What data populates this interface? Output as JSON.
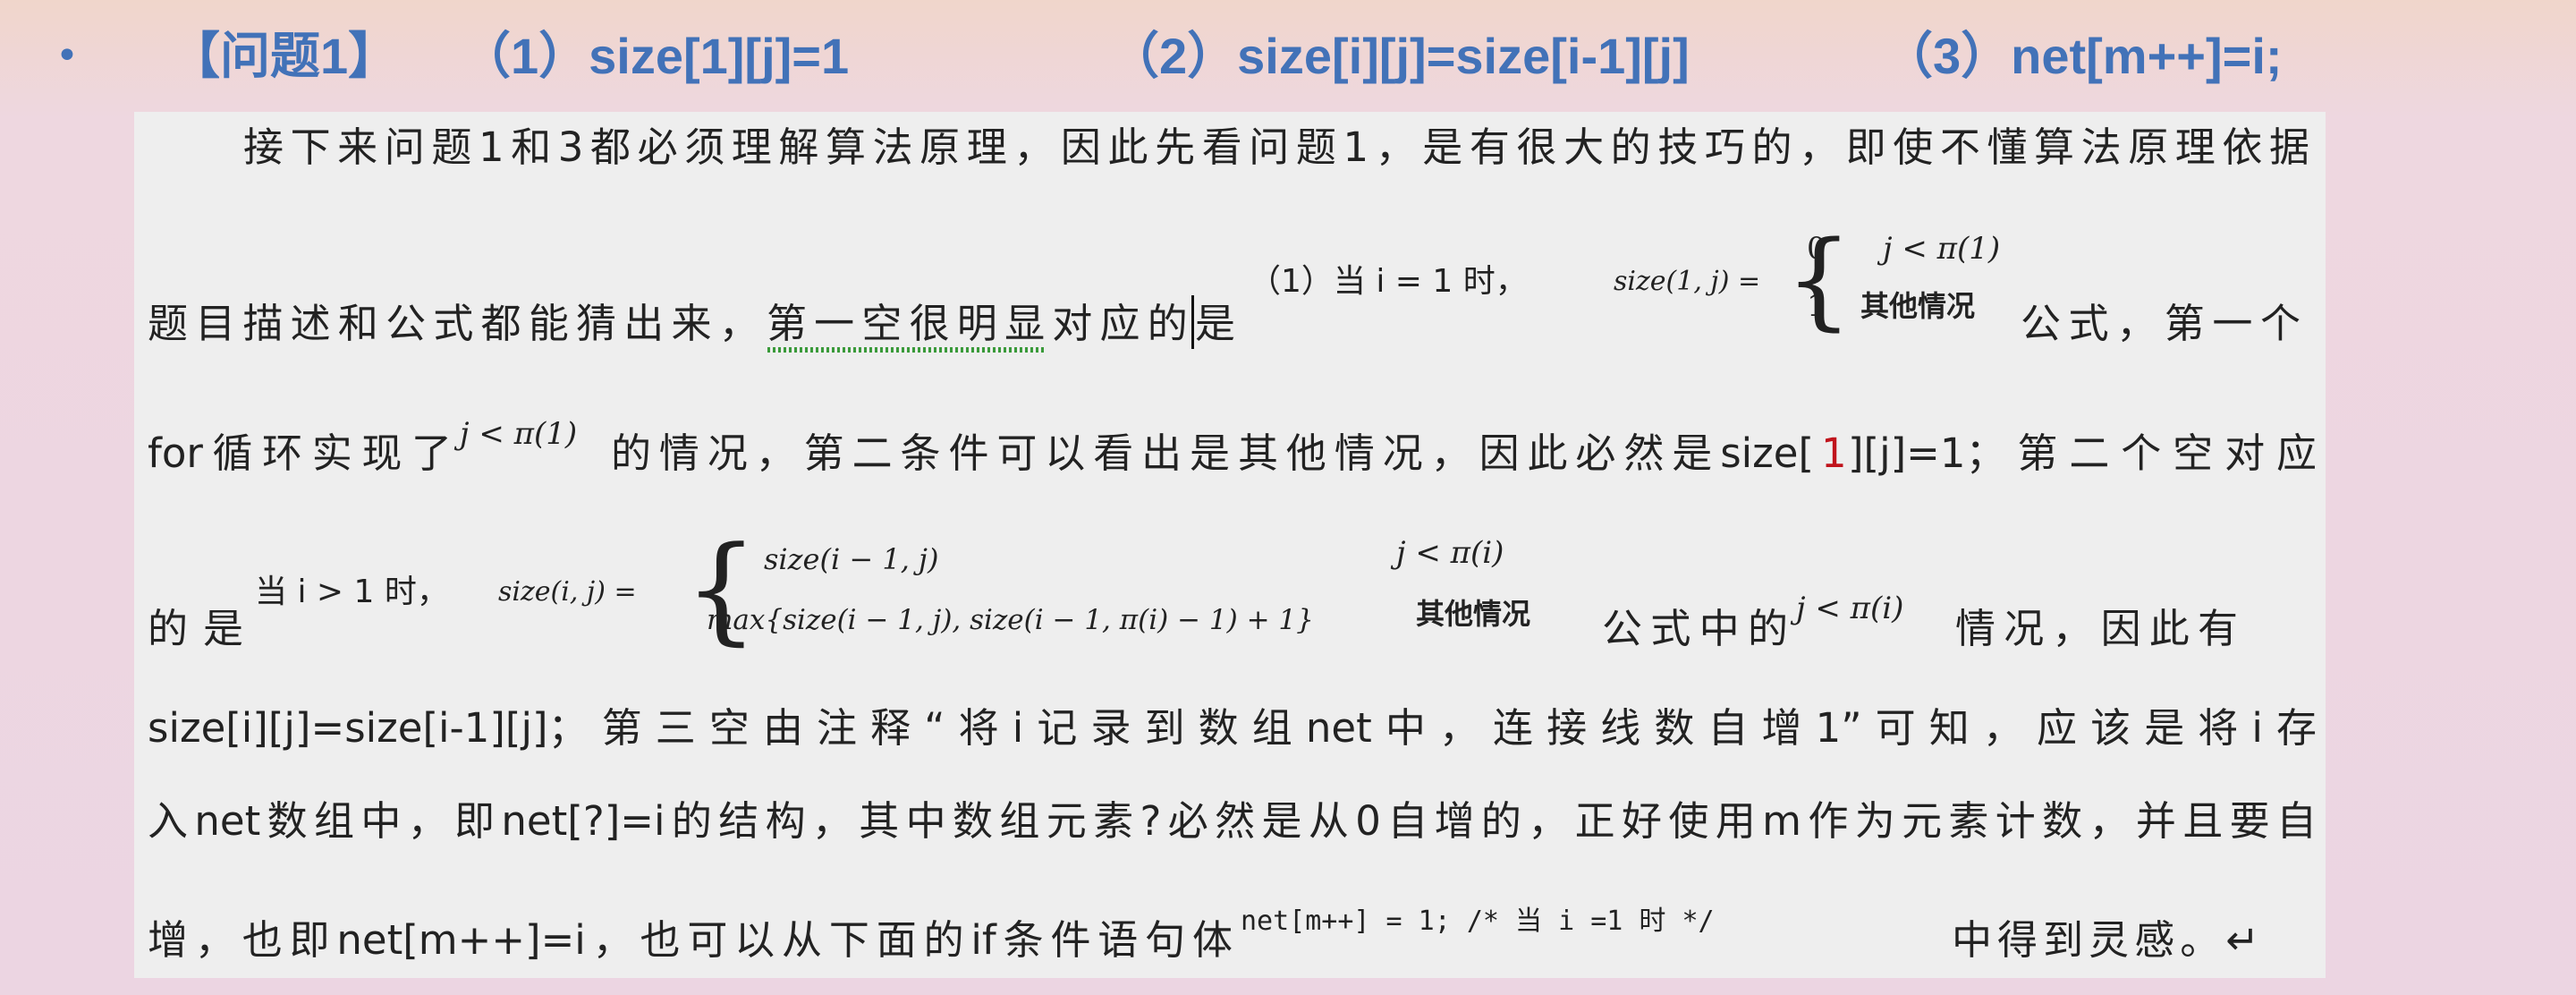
{
  "header": {
    "bullet": "•",
    "title": "【问题1】",
    "answer1": "（1）size[1][j]=1",
    "answer2": "（2）size[i][j]=size[i-1][j]",
    "answer3": "（3）net[m++]=i;"
  },
  "doc": {
    "line1": "接下来问题1和3都必须理解算法原理，因此先看问题1，是有很大的技巧的，即使不懂算法原理依据",
    "line2a": "题目描述和公式都能猜出来，第一空很明显对应的是",
    "formula1": {
      "lead": "（1）当 i = 1 时，",
      "lhs": "size(1, j) =",
      "case1_val": "0",
      "case1_cond": "j < π(1)",
      "case2_val": "1",
      "case2_cond": "其他情况"
    },
    "line2b": "公式，第一个",
    "line3a": "for循环实现了",
    "line3_math": "j < π(1)",
    "line3b": "的情况，第二条件可以看出是其他情况，因此必然是size[",
    "line3_red": "1",
    "line3c": "][j]=1；第二个空对应",
    "line4a": "的是",
    "formula2": {
      "lead": "当 i > 1 时，",
      "lhs": "size(i, j) =",
      "case1_val": "size(i − 1, j)",
      "case1_cond": "j < π(i)",
      "case2_val": "max{size(i − 1, j), size(i − 1, π(i) − 1) + 1}",
      "case2_cond": "其他情况"
    },
    "line4b": "公式中的",
    "line4_math": "j < π(i)",
    "line4c": "情况，因此有",
    "line5": "size[i][j]=size[i-1][j]；第三空由注释“将i记录到数组net中，连接线数自增1”可知，应该是将i存",
    "line6": "入net数组中，即net[?]=i的结构，其中数组元素?必然是从0自增的，正好使用m作为元素计数，并且要自",
    "line7a": "增，也即net[m++]=i，也可以从下面的if条件语句体",
    "line7_code": "net[m++] = 1;   /* 当 i =1 时 */",
    "line7b": "中得到灵感。↵"
  },
  "colors": {
    "heading": "#4272b8",
    "paper": "#eeeeee",
    "highlight": "#c0141c"
  }
}
